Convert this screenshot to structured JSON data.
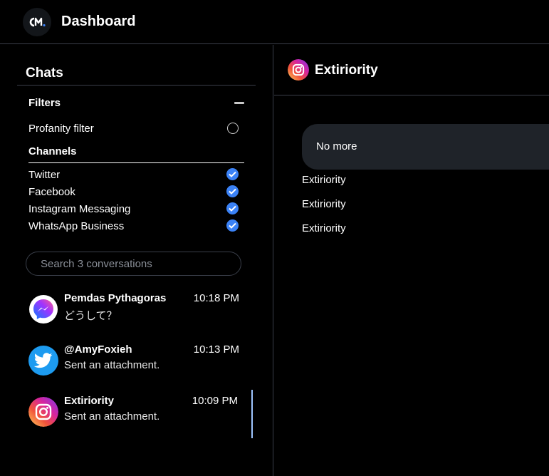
{
  "header": {
    "logo_text": "CM.",
    "title": "Dashboard"
  },
  "sidebar": {
    "title": "Chats",
    "filters": {
      "label": "Filters",
      "profanity_label": "Profanity filter",
      "profanity_checked": false
    },
    "channels": {
      "label": "Channels",
      "items": [
        {
          "label": "Twitter",
          "checked": true
        },
        {
          "label": "Facebook",
          "checked": true
        },
        {
          "label": "Instagram Messaging",
          "checked": true
        },
        {
          "label": "WhatsApp Business",
          "checked": true
        }
      ]
    },
    "search": {
      "placeholder": "Search 3 conversations",
      "value": ""
    },
    "conversations": [
      {
        "name": "Pemdas Pythagoras",
        "time": "10:18 PM",
        "preview": "どうして？",
        "channel_icon": "messenger-icon"
      },
      {
        "name": "@AmyFoxieh",
        "time": "10:13 PM",
        "preview": "Sent an attachment.",
        "channel_icon": "twitter-icon"
      },
      {
        "name": "Extiriority",
        "time": "10:09 PM",
        "preview": "Sent an attachment.",
        "channel_icon": "instagram-icon",
        "active": true
      }
    ]
  },
  "main": {
    "title": "Extiriority",
    "channel_icon": "instagram-icon",
    "bubble_text": "No more",
    "messages": [
      "Extiriority",
      "Extiriority",
      "Extiriority"
    ]
  },
  "colors": {
    "background": "#000000",
    "divider": "#3a3f4a",
    "accent": "#3b82f6",
    "bubble": "#1f2329",
    "active_indicator": "#9ec5ff"
  }
}
